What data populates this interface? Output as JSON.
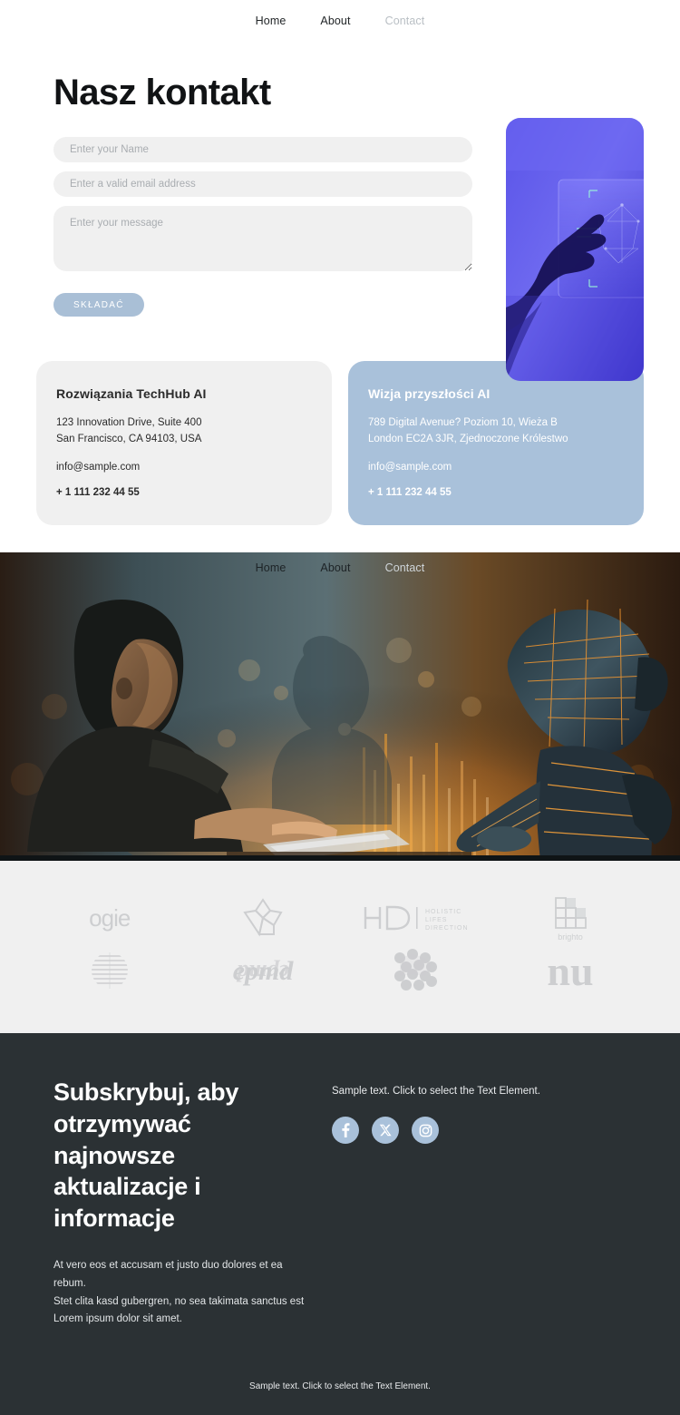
{
  "nav": {
    "items": [
      {
        "label": "Home",
        "muted": false
      },
      {
        "label": "About",
        "muted": false
      },
      {
        "label": "Contact",
        "muted": true
      }
    ]
  },
  "hero": {
    "title": "Nasz kontakt",
    "form": {
      "name_placeholder": "Enter your Name",
      "email_placeholder": "Enter a valid email address",
      "message_placeholder": "Enter your message",
      "submit_label": "SKŁADAĆ"
    },
    "image_alt": "hand-touching-blue-holographic-screen"
  },
  "cards": [
    {
      "title": "Rozwiązania TechHub AI",
      "address_line1": "123 Innovation Drive, Suite 400",
      "address_line2": "San Francisco, CA 94103, USA",
      "email": "info@sample.com",
      "phone": "+ 1 111 232 44 55"
    },
    {
      "title": "Wizja przyszłości AI",
      "address_line1": "789 Digital Avenue? Poziom 10, Wieża B",
      "address_line2": "London EC2A 3JR, Zjednoczone Królestwo",
      "email": "info@sample.com",
      "phone": "+ 1 111 232 44 55"
    }
  ],
  "banner": {
    "image_alt": "woman-typing-beside-glowing-robot",
    "nav": [
      {
        "label": "Home",
        "muted": false
      },
      {
        "label": "About",
        "muted": false
      },
      {
        "label": "Contact",
        "muted": true
      }
    ]
  },
  "logos": [
    {
      "name": "ogie",
      "type": "wordmark"
    },
    {
      "name": "flower-star",
      "type": "mark"
    },
    {
      "name": "HD",
      "sub1": "HOLISTIC",
      "sub2": "LIFES",
      "sub3": "DIRECTION",
      "type": "lockup"
    },
    {
      "name": "brighto",
      "type": "mark-word"
    },
    {
      "name": "striped-sphere",
      "type": "mark"
    },
    {
      "name": "epmd",
      "type": "script-wordmark"
    },
    {
      "name": "dot-pattern",
      "type": "mark"
    },
    {
      "name": "nu",
      "type": "wordmark"
    }
  ],
  "footer": {
    "heading": "Subskrybuj, aby otrzymywać najnowsze aktualizacje i informacje",
    "body_line1": "At vero eos et accusam et justo duo dolores et ea rebum.",
    "body_line2": "Stet clita kasd gubergren, no sea takimata sanctus est",
    "body_line3": "Lorem ipsum dolor sit amet.",
    "sample_text": "Sample text. Click to select the Text Element.",
    "socials": [
      {
        "name": "facebook"
      },
      {
        "name": "x-twitter"
      },
      {
        "name": "instagram"
      }
    ],
    "bottom_text": "Sample text. Click to select the Text Element."
  },
  "colors": {
    "accent_blue": "#a9c1da",
    "footer_dark": "#2b3134",
    "band_gray": "#f0f0f0",
    "muted_link": "#b9bfc4"
  }
}
